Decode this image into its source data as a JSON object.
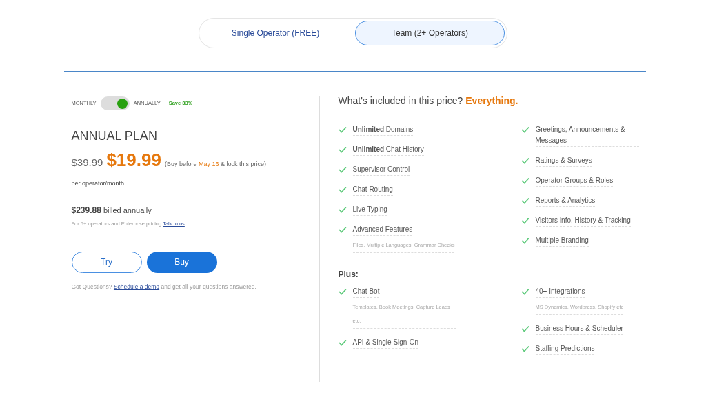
{
  "plan_tabs": [
    {
      "label": "Single Operator (FREE)",
      "selected": false
    },
    {
      "label": "Team (2+ Operators)",
      "selected": true
    }
  ],
  "billing": {
    "left_label": "MONTHLY",
    "right_label": "ANNUALLY",
    "on": true,
    "save": "Save 33%"
  },
  "plan": {
    "title": "ANNUAL PLAN",
    "old_price": "$39.99",
    "price": "$19.99",
    "deadline_before": "(Buy before",
    "deadline_date": "May 16",
    "deadline_after": "& lock this price)",
    "unit": "per operator/month",
    "total": "$239.88",
    "total_note": "billed annually",
    "enterprise_text": "For 5+ operators and Enterprise pricing",
    "enterprise_link": "Talk to us",
    "buttons": [
      {
        "label": "Try",
        "kind": "outline"
      },
      {
        "label": "Buy",
        "kind": "primary"
      }
    ],
    "questions_before": "Got Questions?",
    "questions_link": "Schedule a demo",
    "questions_after": "and get all your questions answered."
  },
  "included": {
    "title": "What's included in this price?",
    "title_highlight": "Everything.",
    "column_1": [
      {
        "label": "**Unlimited** Domains"
      },
      {
        "label": "**Unlimited** Chat History"
      },
      {
        "label": "Supervisor Control"
      },
      {
        "label": "Chat Routing"
      },
      {
        "label": "Live Typing"
      },
      {
        "label": "Advanced Features",
        "sub": "Files, Multiple Languages, Grammar Checks"
      }
    ],
    "column_2": [
      {
        "label": "Greetings, Announcements & Messages"
      },
      {
        "label": "Ratings & Surveys"
      },
      {
        "label": "Operator Groups & Roles"
      },
      {
        "label": "Reports & Analytics"
      },
      {
        "label": "Visitors info, History & Tracking"
      },
      {
        "label": "Multiple Branding"
      }
    ]
  },
  "plus": {
    "title": "Plus:",
    "column_1": [
      {
        "label": "Chat Bot",
        "sub": "Templates, Book Meetings, Capture Leads etc."
      },
      {
        "label": "API & Single Sign-On"
      }
    ],
    "column_2": [
      {
        "label": "40+ Integrations",
        "sub": "MS Dynamics, Wordpress, Shopify etc"
      },
      {
        "label": "Business Hours & Scheduler"
      },
      {
        "label": "Staffing Predictions"
      }
    ]
  }
}
